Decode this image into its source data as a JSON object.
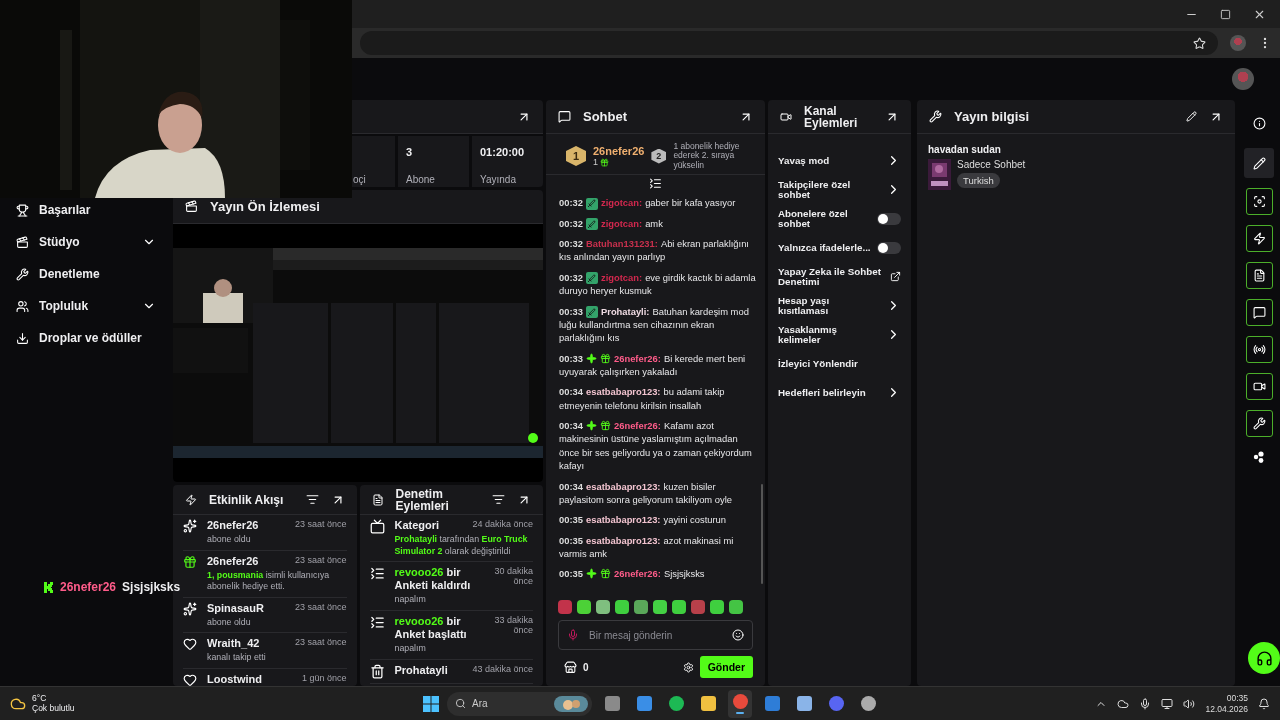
{
  "sidebar": {
    "items": [
      {
        "label": "Başarılar",
        "has_submenu": false
      },
      {
        "label": "Stüdyo",
        "has_submenu": true
      },
      {
        "label": "Denetleme",
        "has_submenu": false
      },
      {
        "label": "Topluluk",
        "has_submenu": true
      },
      {
        "label": "Droplar ve ödüller",
        "has_submenu": false
      }
    ]
  },
  "stream_overlay": {
    "username": "26nefer26",
    "message": "Sjsjsjksks"
  },
  "stats": [
    {
      "label": "oçi"
    },
    {
      "value": "3",
      "label": "Abone"
    },
    {
      "value": "01:20:00",
      "label": "Yayında"
    }
  ],
  "preview": {
    "title": "Yayın Ön İzlemesi"
  },
  "activity": {
    "title": "Etkinlik Akışı",
    "items": [
      {
        "kind": "subscribe",
        "name": "26nefer26",
        "time": "23 saat önce",
        "text": "abone oldu"
      },
      {
        "kind": "gift",
        "name": "26nefer26",
        "time": "23 saat önce",
        "text": "**1, pousmania** isimli kullanıcıya abonelik hediye etti."
      },
      {
        "kind": "subscribe",
        "name": "SpinasauR",
        "time": "23 saat önce",
        "text": "abone oldu"
      },
      {
        "kind": "follow",
        "name": "Wraith_42",
        "time": "23 saat önce",
        "text": "kanalı takip etti"
      },
      {
        "kind": "follow",
        "name": "Loostwind",
        "time": "1 gün önce"
      }
    ]
  },
  "mod_actions": {
    "title": "Denetim Eylemleri",
    "items": [
      {
        "kind": "category",
        "title": "Kategori",
        "time": "24 dakika önce",
        "body": "**Prohatayli** tarafından **Euro Truck Simulator 2** olarak değiştirildi"
      },
      {
        "kind": "poll",
        "user": "revooo26",
        "title": "bir Anketi kaldırdı",
        "time": "30 dakika önce",
        "body": "napalım"
      },
      {
        "kind": "poll",
        "user": "revooo26",
        "title": "bir Anket başlattı",
        "time": "33 dakika önce",
        "body": "napalım"
      },
      {
        "kind": "delete",
        "title": "Prohatayli",
        "time": "43 dakika önce"
      }
    ]
  },
  "chat": {
    "title": "Sohbet",
    "top_gifter": {
      "rank": "1",
      "name": "26nefer26",
      "count": "1"
    },
    "next_rank": {
      "rank": "2",
      "text": "1 abonelik hediye ederek 2. sıraya yükselin"
    },
    "messages": [
      {
        "time": "00:32",
        "kind": "moderator",
        "user": "zigotcan:",
        "color": "#d2284e",
        "text": "gaber bir kafa yasıyor"
      },
      {
        "time": "00:32",
        "kind": "moderator",
        "user": "zigotcan:",
        "color": "#d2284e",
        "text": "amk"
      },
      {
        "time": "00:32",
        "kind": "viewer",
        "user": "Batuhan131231:",
        "color": "#c8304d",
        "text": "Abi ekran parlaklığını kıs anlından yayın parlıyp"
      },
      {
        "time": "00:32",
        "kind": "moderator",
        "user": "zigotcan:",
        "color": "#d2284e",
        "text": "eve girdik kactık bi adamla duruyo heryer kusmuk"
      },
      {
        "time": "00:33",
        "kind": "moderator",
        "user": "Prohatayli:",
        "color": "#f0dce4",
        "text": "Batuhan kardeşim mod luğu kullandırtma sen cihazının ekran parlaklığını kıs"
      },
      {
        "time": "00:33",
        "kind": "subscriber",
        "user": "26nefer26:",
        "color": "#ff5c8a",
        "text": "Bi kerede mert beni uyuyarak çalışırken yakaladı"
      },
      {
        "time": "00:34",
        "kind": "viewer",
        "user": "esatbabapro123:",
        "color": "#f2c4d0",
        "text": "bu adami takip etmeyenin telefonu kirilsin insallah"
      },
      {
        "time": "00:34",
        "kind": "subscriber",
        "user": "26nefer26:",
        "color": "#ff5c8a",
        "text": "Kafamı azot makinesinin üstüne yaslamıştım açılmadan önce bir ses geliyordu ya o zaman çekiyordum kafayı"
      },
      {
        "time": "00:34",
        "kind": "viewer",
        "user": "esatbabapro123:",
        "color": "#f2c4d0",
        "text": "kuzen bisiler paylasitom sonra geliyorum takiliyom oyle"
      },
      {
        "time": "00:35",
        "kind": "viewer",
        "user": "esatbabapro123:",
        "color": "#f2c4d0",
        "text": "yayini costurun"
      },
      {
        "time": "00:35",
        "kind": "viewer",
        "user": "esatbabapro123:",
        "color": "#f2c4d0",
        "text": "azot makinasi mi varmis amk"
      },
      {
        "time": "00:35",
        "kind": "subscriber",
        "user": "26nefer26:",
        "color": "#ff5c8a",
        "text": "Sjsjsjksks"
      }
    ],
    "emotes": [
      {
        "color": "#c2334a"
      },
      {
        "color": "#4cd137"
      },
      {
        "color": "#7fbf7f"
      },
      {
        "color": "#3fcf3f"
      },
      {
        "color": "#5aa85a"
      },
      {
        "color": "#44d144"
      },
      {
        "color": "#3fcf3f"
      },
      {
        "color": "#b8404a"
      },
      {
        "color": "#3fcf3f"
      },
      {
        "color": "#44c444"
      }
    ],
    "input": {
      "placeholder": "Bir mesaj gönderin"
    },
    "points": "0",
    "send": "Gönder"
  },
  "channel_actions": {
    "title": "Kanal Eylemleri",
    "items": [
      {
        "kind": "submenu",
        "label": "Yavaş mod"
      },
      {
        "kind": "submenu",
        "label": "Takipçilere özel sohbet"
      },
      {
        "kind": "toggle",
        "label": "Abonelere özel sohbet",
        "on": false
      },
      {
        "kind": "toggle",
        "label": "Yalnızca ifadelerle...",
        "on": false
      },
      {
        "kind": "external",
        "label": "Yapay Zeka ile Sohbet Denetimi"
      },
      {
        "kind": "submenu",
        "label": "Hesap yaşı kısıtlaması"
      },
      {
        "kind": "submenu",
        "label": "Yasaklanmış kelimeler"
      },
      {
        "kind": "plain",
        "label": "İzleyici Yönlendir"
      },
      {
        "kind": "submenu",
        "label": "Hedefleri belirleyin"
      }
    ]
  },
  "stream_info": {
    "title": "Yayın bilgisi",
    "stream_title": "havadan sudan",
    "category": "Sadece Sohbet",
    "tags": [
      "Turkish"
    ]
  },
  "right_bar": [
    {
      "kind": "info"
    },
    {
      "kind": "edit"
    },
    {
      "kind": "camera"
    },
    {
      "kind": "bolt"
    },
    {
      "kind": "notes"
    },
    {
      "kind": "chat"
    },
    {
      "kind": "broadcast"
    },
    {
      "kind": "video"
    },
    {
      "kind": "wrench"
    },
    {
      "kind": "dots"
    }
  ],
  "taskbar": {
    "temperature": "6°C",
    "weather": "Çok bulutlu",
    "search": "Ara",
    "apps": [
      {
        "kind": "taskview",
        "active": false
      },
      {
        "kind": "store",
        "active": false
      },
      {
        "kind": "music",
        "active": false
      },
      {
        "kind": "folder",
        "active": false
      },
      {
        "kind": "browser",
        "active": true
      },
      {
        "kind": "mail",
        "active": false
      },
      {
        "kind": "game",
        "active": false
      },
      {
        "kind": "discord",
        "active": false
      },
      {
        "kind": "recorder",
        "active": false
      }
    ],
    "time": "00:35",
    "date": "12.04.2026"
  }
}
